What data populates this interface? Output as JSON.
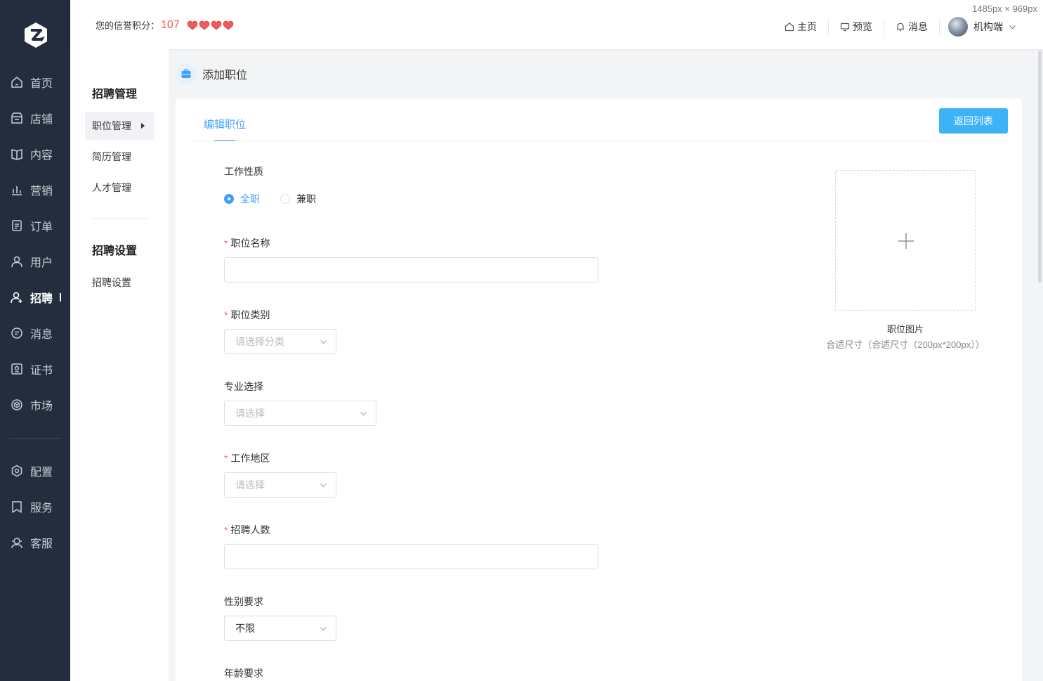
{
  "dimension_label": "1485px × 969px",
  "sidebar": {
    "items": [
      {
        "label": "首页",
        "icon": "home-icon"
      },
      {
        "label": "店铺",
        "icon": "shop-icon"
      },
      {
        "label": "内容",
        "icon": "content-icon"
      },
      {
        "label": "营销",
        "icon": "marketing-icon"
      },
      {
        "label": "订单",
        "icon": "order-icon"
      },
      {
        "label": "用户",
        "icon": "user-icon"
      },
      {
        "label": "招聘",
        "icon": "recruit-icon",
        "active": true
      },
      {
        "label": "消息",
        "icon": "message-icon"
      },
      {
        "label": "证书",
        "icon": "certificate-icon"
      },
      {
        "label": "市场",
        "icon": "market-icon"
      },
      {
        "label": "配置",
        "icon": "settings-icon"
      },
      {
        "label": "服务",
        "icon": "service-icon"
      },
      {
        "label": "客服",
        "icon": "customer-service-icon"
      }
    ]
  },
  "header": {
    "credit_label": "您的信誉积分：",
    "credit_score": "107",
    "hearts": 4,
    "links": {
      "home": "主页",
      "preview": "预览",
      "messages": "消息",
      "account": "机构端"
    }
  },
  "submenu": {
    "section1_title": "招聘管理",
    "section1_items": [
      "职位管理",
      "简历管理",
      "人才管理"
    ],
    "section2_title": "招聘设置",
    "section2_items": [
      "招聘设置"
    ]
  },
  "page": {
    "title": "添加职位",
    "tab": "编辑职位",
    "back_button": "返回列表"
  },
  "form": {
    "job_type": {
      "label": "工作性质",
      "options": [
        "全职",
        "兼职"
      ],
      "selected": "全职"
    },
    "job_name": {
      "label": "职位名称",
      "value": ""
    },
    "job_category": {
      "label": "职位类别",
      "placeholder": "请选择分类"
    },
    "major": {
      "label": "专业选择",
      "placeholder": "请选择"
    },
    "work_area": {
      "label": "工作地区",
      "placeholder": "请选择"
    },
    "headcount": {
      "label": "招聘人数",
      "value": ""
    },
    "gender": {
      "label": "性别要求",
      "value": "不限"
    },
    "age": {
      "label": "年龄要求"
    },
    "image": {
      "label": "职位图片",
      "hint": "合适尺寸（合适尺寸（200px*200px））"
    }
  },
  "colors": {
    "sidebar_bg": "#232d3d",
    "accent": "#409eff",
    "button": "#3cb3f7",
    "required": "#f56c6c",
    "score": "#f05a5a"
  }
}
